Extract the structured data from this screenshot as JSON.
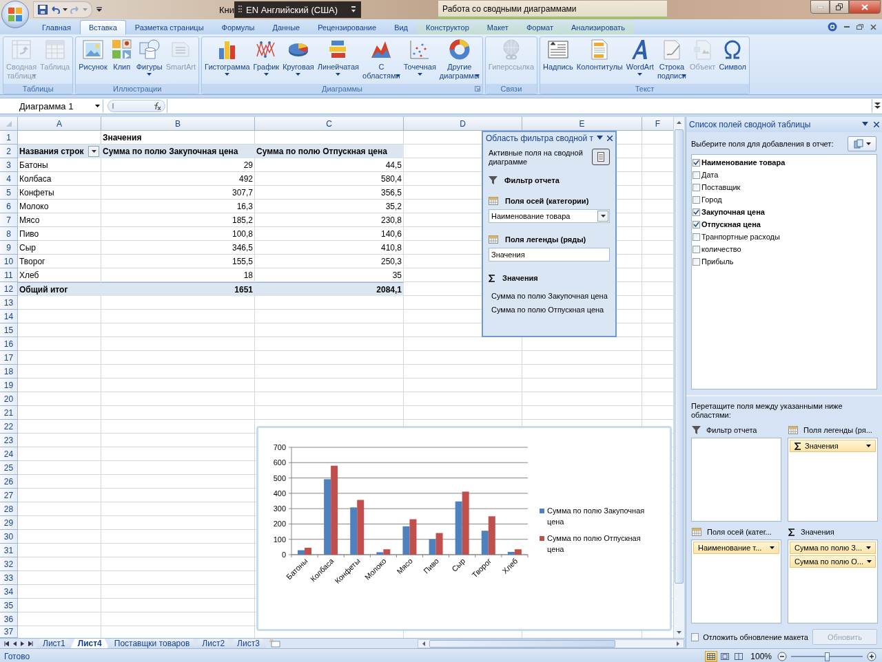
{
  "title_bar": {
    "document_title": "Кни",
    "language_bar": "EN Английский (США)",
    "context_title": "Работа со сводными диаграммами"
  },
  "ribbon_tabs": [
    {
      "label": "Главная",
      "selected": false,
      "contextual": false
    },
    {
      "label": "Вставка",
      "selected": true,
      "contextual": false
    },
    {
      "label": "Разметка страницы",
      "selected": false,
      "contextual": false
    },
    {
      "label": "Формулы",
      "selected": false,
      "contextual": false
    },
    {
      "label": "Данные",
      "selected": false,
      "contextual": false
    },
    {
      "label": "Рецензирование",
      "selected": false,
      "contextual": false
    },
    {
      "label": "Вид",
      "selected": false,
      "contextual": false
    },
    {
      "label": "Конструктор",
      "selected": false,
      "contextual": true
    },
    {
      "label": "Макет",
      "selected": false,
      "contextual": true
    },
    {
      "label": "Формат",
      "selected": false,
      "contextual": true
    },
    {
      "label": "Анализировать",
      "selected": false,
      "contextual": true
    }
  ],
  "ribbon_groups": [
    {
      "label": "Таблицы",
      "launcher": false,
      "buttons": [
        {
          "label": "Сводная\nтаблица",
          "disabled": true,
          "dropdown": true
        },
        {
          "label": "Таблица",
          "disabled": true,
          "dropdown": false
        }
      ]
    },
    {
      "label": "Иллюстрации",
      "launcher": false,
      "buttons": [
        {
          "label": "Рисунок",
          "disabled": false,
          "dropdown": false
        },
        {
          "label": "Клип",
          "disabled": false,
          "dropdown": false
        },
        {
          "label": "Фигуры",
          "disabled": false,
          "dropdown": true
        },
        {
          "label": "SmartArt",
          "disabled": true,
          "dropdown": false
        }
      ]
    },
    {
      "label": "Диаграммы",
      "launcher": true,
      "buttons": [
        {
          "label": "Гистограмма",
          "disabled": false,
          "dropdown": true
        },
        {
          "label": "График",
          "disabled": false,
          "dropdown": true
        },
        {
          "label": "Круговая",
          "disabled": false,
          "dropdown": true
        },
        {
          "label": "Линейчатая",
          "disabled": false,
          "dropdown": true
        },
        {
          "label": "С\nобластями",
          "disabled": false,
          "dropdown": true
        },
        {
          "label": "Точечная",
          "disabled": false,
          "dropdown": true
        },
        {
          "label": "Другие\nдиаграммы",
          "disabled": false,
          "dropdown": true
        }
      ]
    },
    {
      "label": "Связи",
      "launcher": false,
      "buttons": [
        {
          "label": "Гиперссылка",
          "disabled": true,
          "dropdown": false
        }
      ]
    },
    {
      "label": "Текст",
      "launcher": false,
      "buttons": [
        {
          "label": "Надпись",
          "disabled": false,
          "dropdown": false
        },
        {
          "label": "Колонтитулы",
          "disabled": false,
          "dropdown": false
        },
        {
          "label": "WordArt",
          "disabled": false,
          "dropdown": true
        },
        {
          "label": "Строка\nподписи",
          "disabled": false,
          "dropdown": true
        },
        {
          "label": "Объект",
          "disabled": true,
          "dropdown": false
        },
        {
          "label": "Символ",
          "disabled": false,
          "dropdown": false
        }
      ]
    }
  ],
  "formula_bar": {
    "name_box": "Диаграмма 1"
  },
  "sheet": {
    "columns": [
      "A",
      "B",
      "C",
      "D",
      "E",
      "F"
    ],
    "row_numbers": [
      "1",
      "2",
      "3",
      "4",
      "5",
      "6",
      "7",
      "8",
      "9",
      "10",
      "11",
      "12",
      "13",
      "14",
      "15",
      "16",
      "17",
      "18",
      "19",
      "20",
      "21",
      "22",
      "23",
      "24",
      "25",
      "26",
      "27",
      "28",
      "29",
      "30",
      "31",
      "32",
      "33",
      "34",
      "35",
      "36",
      "37"
    ],
    "pivot": {
      "header": "Значения",
      "row_label_header": "Названия строк",
      "columns": [
        "Сумма по полю Закупочная цена",
        "Сумма по полю Отпускная цена"
      ],
      "rows": [
        {
          "label": "Батоны",
          "values": [
            "29",
            "44,5"
          ]
        },
        {
          "label": "Колбаса",
          "values": [
            "492",
            "580,4"
          ]
        },
        {
          "label": "Конфеты",
          "values": [
            "307,7",
            "356,5"
          ]
        },
        {
          "label": "Молоко",
          "values": [
            "16,3",
            "35,2"
          ]
        },
        {
          "label": "Мясо",
          "values": [
            "185,2",
            "230,8"
          ]
        },
        {
          "label": "Пиво",
          "values": [
            "100,8",
            "140,6"
          ]
        },
        {
          "label": "Сыр",
          "values": [
            "346,5",
            "410,8"
          ]
        },
        {
          "label": "Творог",
          "values": [
            "155,5",
            "250,3"
          ]
        },
        {
          "label": "Хлеб",
          "values": [
            "18",
            "35"
          ]
        }
      ],
      "total": {
        "label": "Общий итог",
        "values": [
          "1651",
          "2084,1"
        ]
      }
    },
    "chart": {
      "chart_data": {
        "type": "bar",
        "categories": [
          "Батоны",
          "Колбаса",
          "Конфеты",
          "Молоко",
          "Мясо",
          "Пиво",
          "Сыр",
          "Творог",
          "Хлеб"
        ],
        "series": [
          {
            "name": "Сумма по полю Закупочная цена",
            "color": "#4f81bd",
            "values": [
              29,
              492,
              308,
              16,
              185,
              101,
              347,
              156,
              18
            ]
          },
          {
            "name": "Сумма по полю Отпускная цена",
            "color": "#c0504d",
            "values": [
              45,
              580,
              357,
              35,
              231,
              141,
              411,
              250,
              35
            ]
          }
        ],
        "ylim": [
          0,
          700
        ],
        "grid": true,
        "legend": "right",
        "yticks": [
          0,
          100,
          200,
          300,
          400,
          500,
          600,
          700
        ]
      }
    }
  },
  "filter_pane": {
    "title": "Область фильтра сводной т",
    "subtitle": "Активные поля на сводной диаграмме",
    "sections": [
      {
        "kind": "filter",
        "label": "Фильтр отчета"
      },
      {
        "kind": "axis",
        "label": "Поля осей (категории)",
        "field": "Наименование товара"
      },
      {
        "kind": "legend",
        "label": "Поля легенды (ряды)",
        "field": "Значения"
      },
      {
        "kind": "values",
        "label": "Значения",
        "items": [
          "Сумма по полю Закупочная цена",
          "Сумма по полю Отпускная цена"
        ]
      }
    ]
  },
  "field_list": {
    "title": "Список полей сводной таблицы",
    "prompt": "Выберите поля для добавления в отчет:",
    "fields": [
      {
        "label": "Наименование товара",
        "checked": true
      },
      {
        "label": "Дата",
        "checked": false
      },
      {
        "label": "Поставщик",
        "checked": false
      },
      {
        "label": "Город",
        "checked": false
      },
      {
        "label": "Закупочная цена",
        "checked": true
      },
      {
        "label": "Отпускная цена",
        "checked": true
      },
      {
        "label": "Транпортные расходы",
        "checked": false
      },
      {
        "label": "количество",
        "checked": false
      },
      {
        "label": "Прибыль",
        "checked": false
      }
    ],
    "drag_prompt": "Перетащите поля между указанными ниже областями:",
    "areas": [
      {
        "kind": "filter",
        "label": "Фильтр отчета"
      },
      {
        "kind": "legend",
        "label": "Поля легенды (ря...",
        "items": [
          "Значения"
        ]
      },
      {
        "kind": "axis",
        "label": "Поля осей (катег...",
        "items": [
          "Наименование т..."
        ]
      },
      {
        "kind": "values",
        "label": "Значения",
        "items": [
          "Сумма по полю З...",
          "Сумма по полю О..."
        ]
      }
    ],
    "defer": {
      "label": "Отложить обновление макета",
      "checked": false
    },
    "update_button": {
      "label": "Обновить",
      "disabled": true
    }
  },
  "sheet_tabs": [
    {
      "label": "Лист1",
      "selected": false
    },
    {
      "label": "Лист4",
      "selected": true
    },
    {
      "label": "Поставщки товаров",
      "selected": false
    },
    {
      "label": "Лист2",
      "selected": false
    },
    {
      "label": "Лист3",
      "selected": false
    }
  ],
  "status_bar": {
    "status": "Готово",
    "view_buttons": [
      {
        "selected": true
      },
      {
        "selected": false
      },
      {
        "selected": false
      }
    ],
    "zoom_label": "100%",
    "zoom": {
      "level": 0.5
    }
  }
}
